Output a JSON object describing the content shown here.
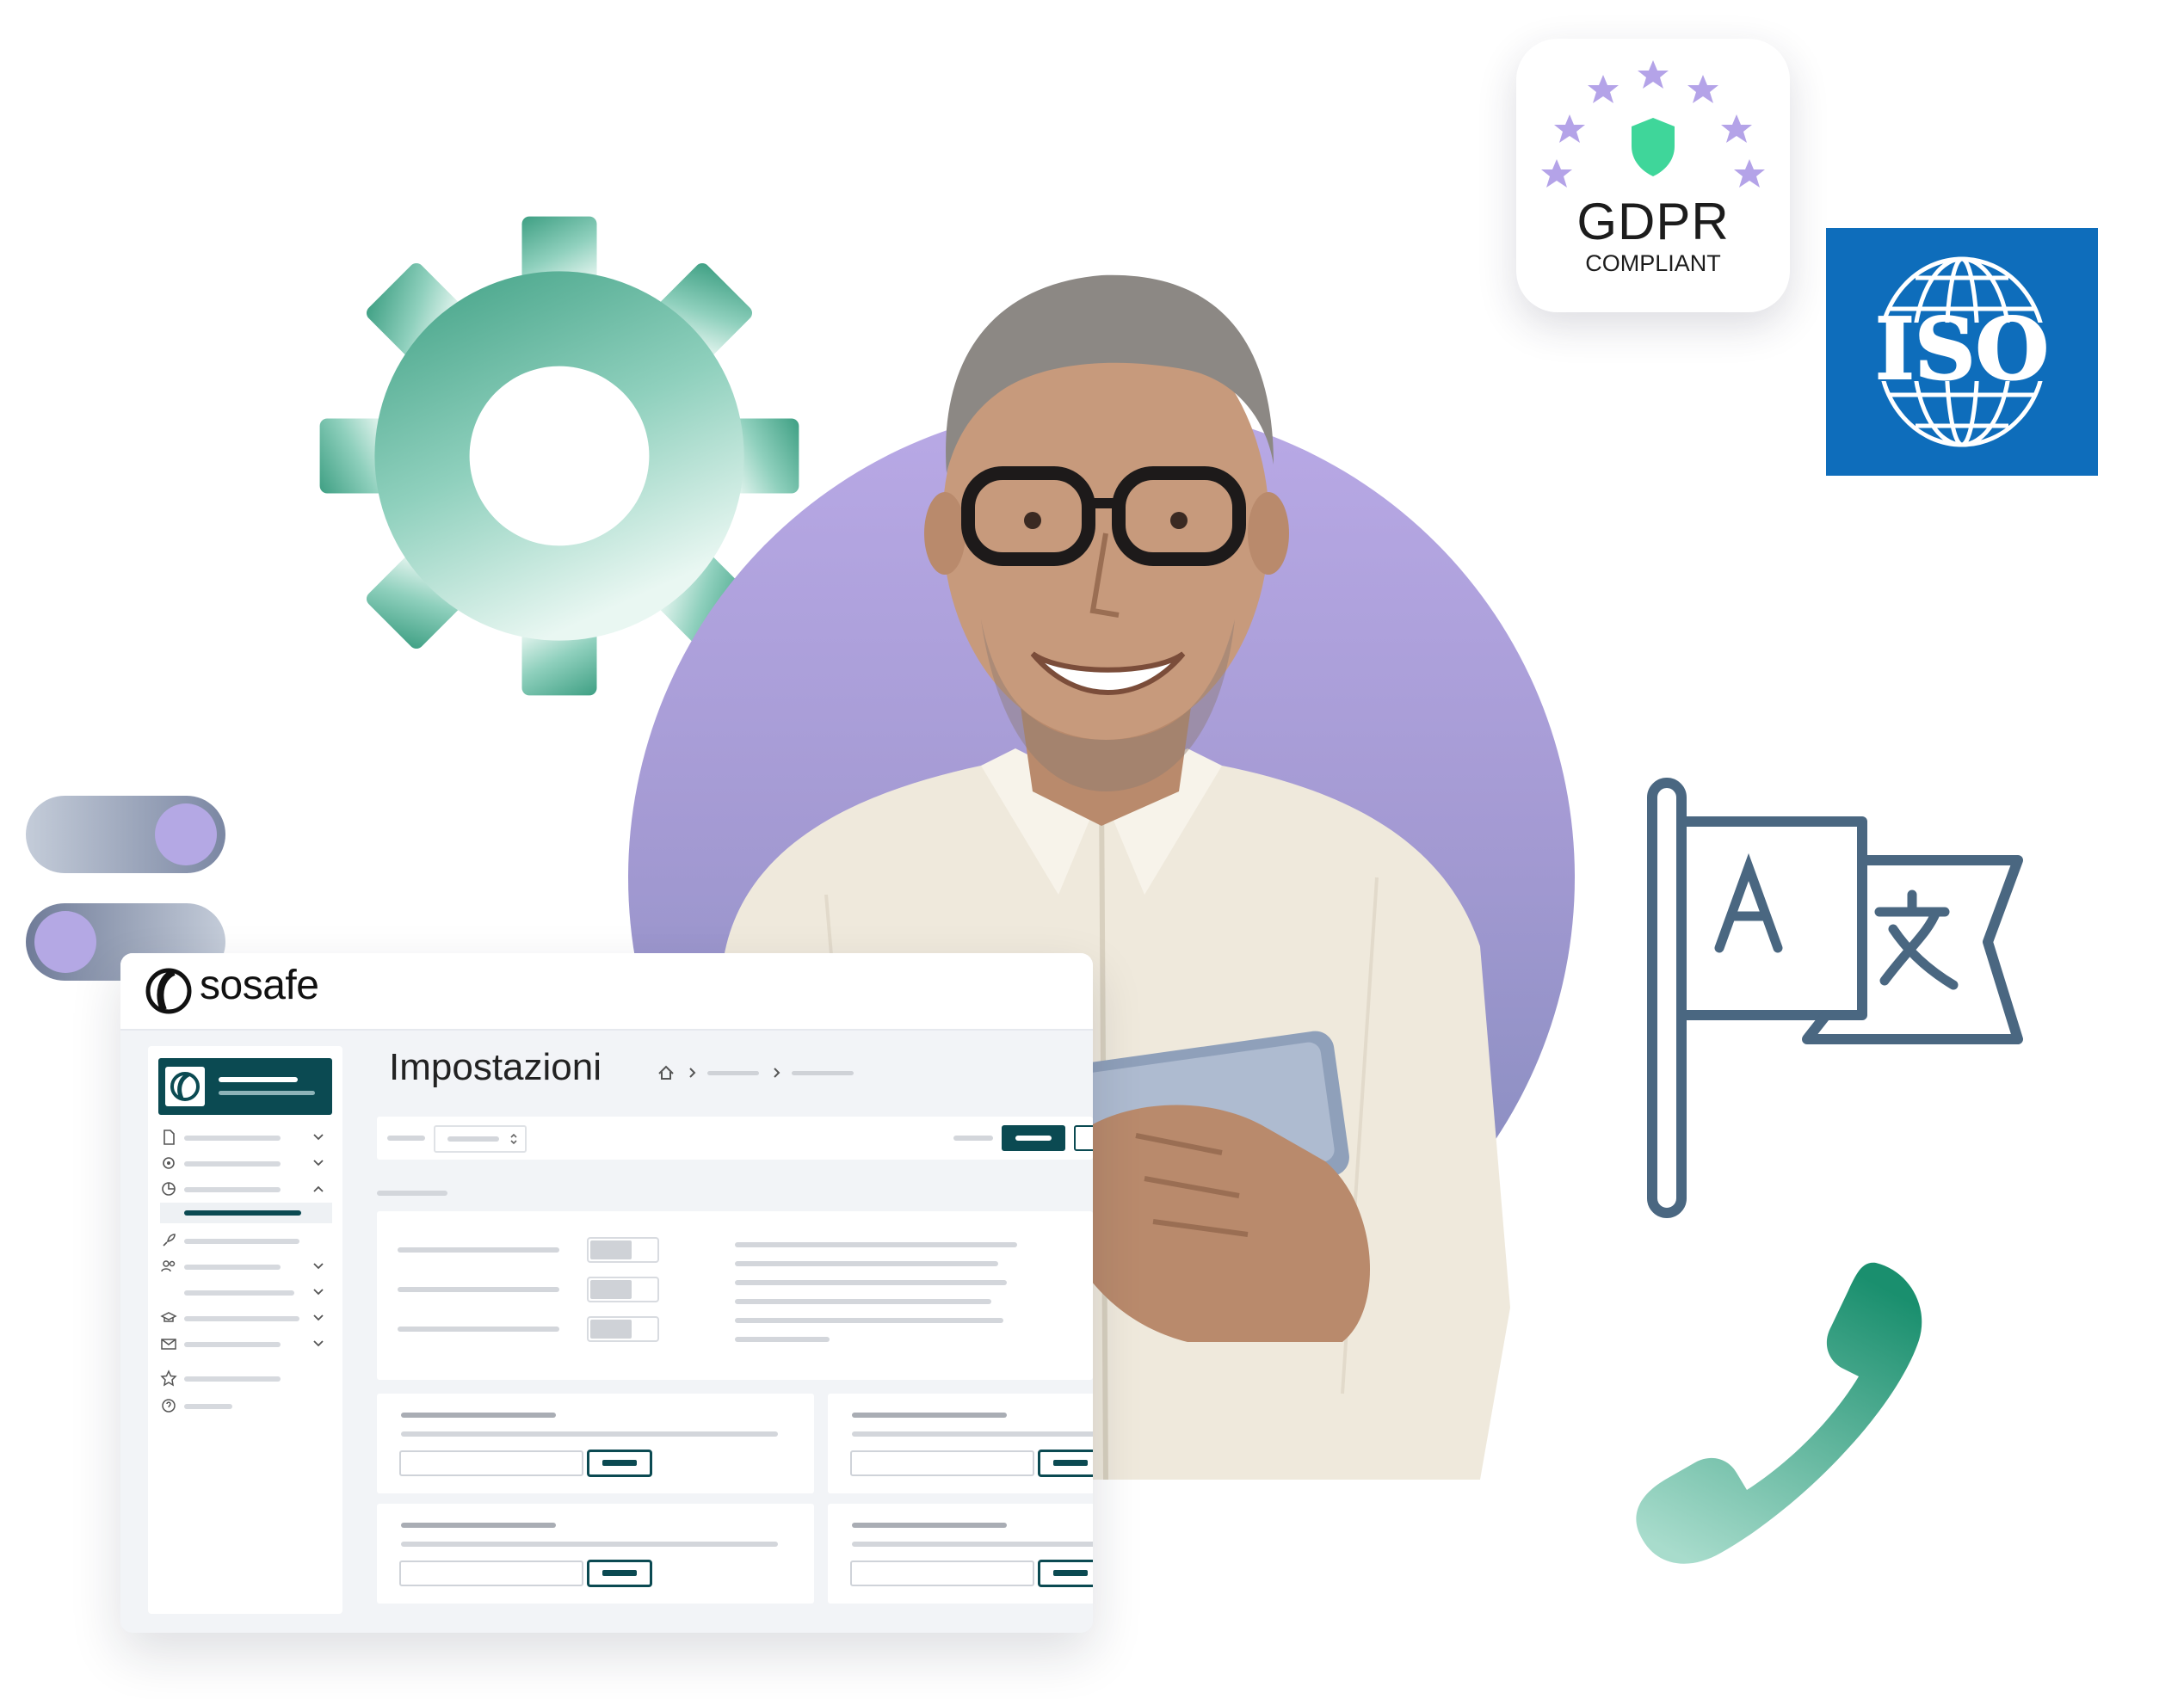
{
  "brand": {
    "name": "sosafe"
  },
  "page": {
    "title": "Impostazioni"
  },
  "badges": {
    "gdpr": {
      "title": "GDPR",
      "subtitle": "COMPLIANT"
    },
    "iso": {
      "text": "ISO"
    }
  },
  "icons": {
    "gear": "gear-icon",
    "translate": "translate-flag-icon",
    "phone": "phone-icon",
    "shield": "shield-icon",
    "globe": "globe-icon"
  },
  "colors": {
    "brand_dark": "#0b4a52",
    "gear_green": "#4aa88f",
    "circle_purple": "#b4a8e4",
    "iso_blue": "#0e6dbb",
    "flag_slate": "#4a6781",
    "gdpr_shield": "#3fd69a",
    "gdpr_stars": "#b4a3e8"
  }
}
